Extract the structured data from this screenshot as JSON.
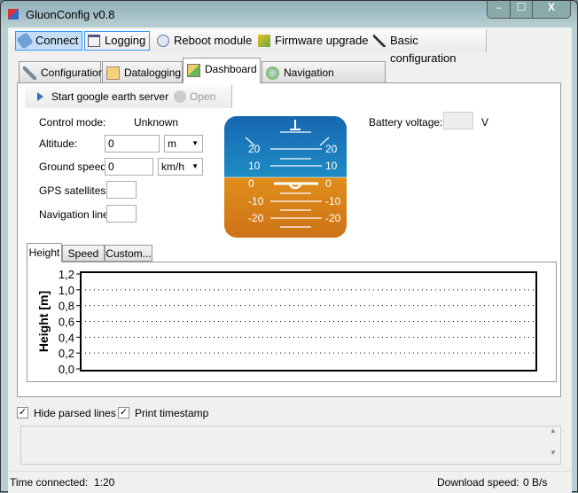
{
  "window": {
    "title": "GluonConfig v0.8"
  },
  "toolbar": [
    {
      "label": "Connect",
      "icon": "plug-icon"
    },
    {
      "label": "Logging",
      "icon": "window-icon"
    },
    {
      "label": "Reboot module",
      "icon": "reboot-icon"
    },
    {
      "label": "Firmware upgrade",
      "icon": "firmware-icon"
    },
    {
      "label": "Basic configuration",
      "icon": "wand-icon"
    }
  ],
  "tabs": [
    {
      "label": "Configuration"
    },
    {
      "label": "Datalogging"
    },
    {
      "label": "Dashboard"
    },
    {
      "label": "Navigation (depricated)"
    }
  ],
  "active_tab": "Dashboard",
  "dash_toolbar": {
    "start": "Start google earth server",
    "open": "Open"
  },
  "fields": {
    "control_mode_label": "Control mode:",
    "control_mode_value": "Unknown",
    "altitude_label": "Altitude:",
    "altitude_value": "0",
    "altitude_unit": "m",
    "ground_speed_label": "Ground speed:",
    "ground_speed_value": "0",
    "speed_unit": "km/h",
    "gps_label": "GPS satellites:",
    "gps_value": "",
    "nav_label": "Navigation line:",
    "nav_value": "",
    "battery_label": "Battery voltage:",
    "battery_value": "",
    "battery_unit": "V"
  },
  "horizon": {
    "pitch_labels": [
      "20",
      "10",
      "0",
      "-10",
      "-20"
    ],
    "sky_color": "#1a6fb4",
    "ground_color": "#d9861a"
  },
  "chart_tabs": [
    {
      "label": "Height"
    },
    {
      "label": "Speed"
    },
    {
      "label": "Custom..."
    }
  ],
  "chart_data": {
    "type": "line",
    "ylabel": "Height [m]",
    "ylim": [
      0,
      1.2
    ],
    "yticks": [
      "0,0",
      "0,2",
      "0,4",
      "0,6",
      "0,8",
      "1,0",
      "1,2"
    ],
    "grid": true,
    "series": []
  },
  "options": {
    "hide_parsed": "Hide parsed lines",
    "hide_parsed_checked": true,
    "print_ts": "Print timestamp",
    "print_ts_checked": true
  },
  "log_text": "",
  "status": {
    "time_label": "Time connected:",
    "time_value": "1:20",
    "speed_label": "Download speed:",
    "speed_value": "0 B/s"
  }
}
